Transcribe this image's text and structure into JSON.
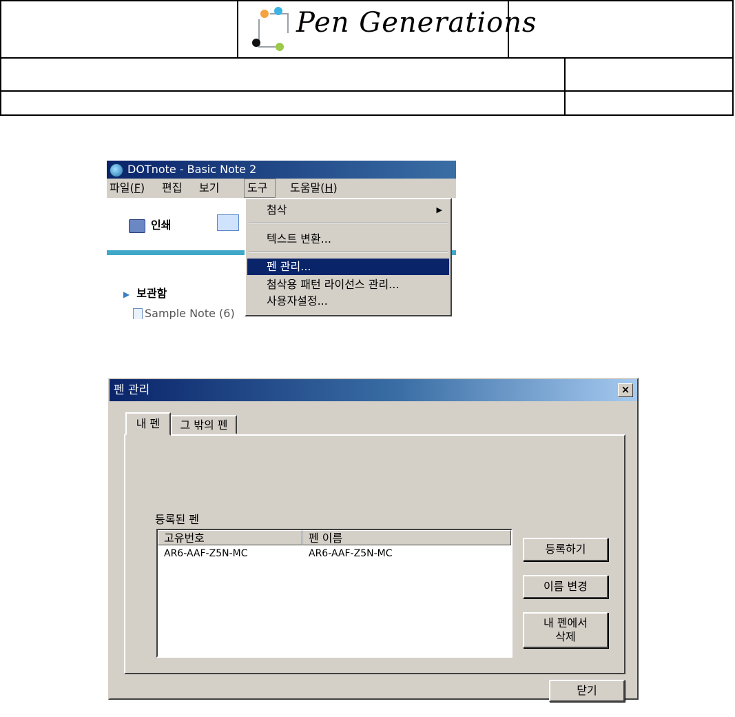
{
  "header": {
    "brand": "Pen Generations"
  },
  "menu_screenshot": {
    "window_title": "DOTnote - Basic Note 2",
    "menubar": [
      {
        "pre": "파일(",
        "key": "F",
        "post": ")"
      },
      {
        "pre": "편집",
        "key": "",
        "post": ""
      },
      {
        "pre": "보기",
        "key": "",
        "post": ""
      },
      {
        "pre": "도구",
        "key": "",
        "post": ""
      },
      {
        "pre": "도움말(",
        "key": "H",
        "post": ")"
      }
    ],
    "toolbar": {
      "print_label": "인쇄"
    },
    "sidebar": {
      "folder": "보관함",
      "note": "Sample Note (6)"
    },
    "dropdown": [
      {
        "label": "첨삭",
        "has_submenu": true
      },
      {
        "label": "텍스트 변환..."
      },
      {
        "label": "펜 관리...",
        "selected": true
      },
      {
        "label": "첨삭용 패턴 라이선스 관리..."
      },
      {
        "label": "사용자설정..."
      }
    ]
  },
  "dialog": {
    "title": "펜 관리",
    "close": "×",
    "tabs": [
      "내 펜",
      "그 밖의 펜"
    ],
    "group_label": "등록된 펜",
    "columns": [
      "고유번호",
      "펜 이름"
    ],
    "rows": [
      [
        "AR6-AAF-Z5N-MC",
        "AR6-AAF-Z5N-MC"
      ]
    ],
    "buttons": {
      "register": "등록하기",
      "rename": "이름 변경",
      "delete_line1": "내 펜에서",
      "delete_line2": "삭제",
      "close": "닫기"
    }
  },
  "colors": {
    "titlebar": "#0a246a",
    "face": "#d4d0c8",
    "accent_teal": "#41a7c9"
  }
}
